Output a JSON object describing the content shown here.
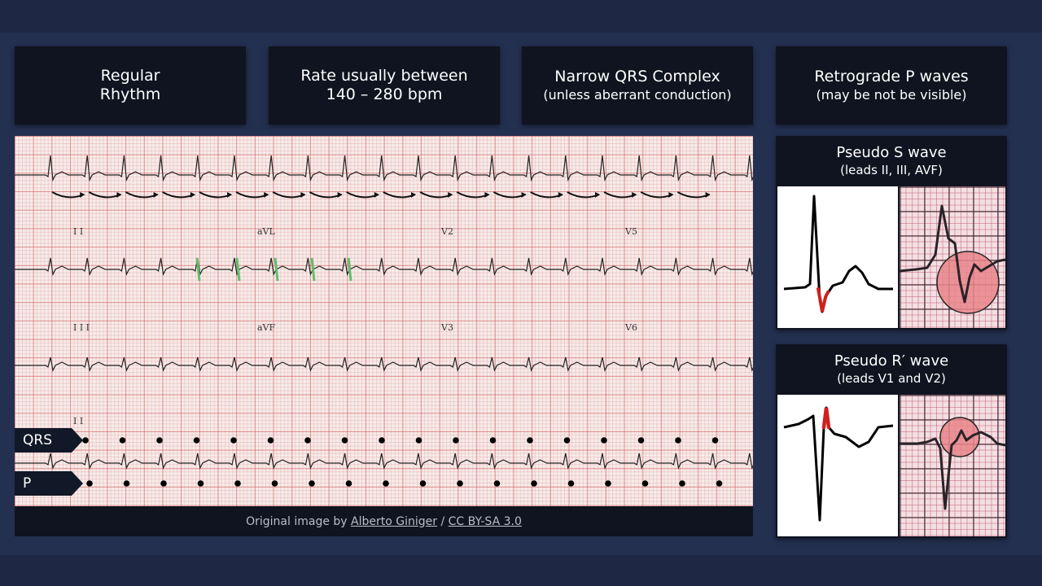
{
  "criteria_cards": [
    {
      "line1": "Regular",
      "line2": "Rhythm",
      "sub": ""
    },
    {
      "line1": "Rate usually between",
      "line2": "140 – 280 bpm",
      "sub": ""
    },
    {
      "line1": "Narrow QRS Complex",
      "line2": "",
      "sub": "(unless aberrant conduction)"
    },
    {
      "line1": "Retrograde P waves",
      "line2": "",
      "sub": "(may be not be visible)"
    }
  ],
  "ecg": {
    "lead_labels": {
      "ii_top": "I I",
      "avl": "aVL",
      "v2": "V2",
      "v5": "V5",
      "iii": "I I I",
      "avf": "aVF",
      "v3": "V3",
      "v6": "V6",
      "ii_rhythm": "I I"
    },
    "markers": {
      "qrs_label": "QRS",
      "p_label": "P",
      "qrs_count": 18,
      "p_count": 18
    },
    "colors": {
      "trace": "#222222",
      "arrow": "#111111",
      "highlight": "#5fbf6a",
      "dot": "#000000"
    }
  },
  "caption": {
    "prefix": "Original image by ",
    "author": "Alberto Giniger",
    "separator": " / ",
    "license": "CC BY-SA 3.0"
  },
  "side_panels": {
    "pseudo_s": {
      "title": "Pseudo S wave",
      "subtitle": "(leads II, III, AVF)"
    },
    "pseudo_r": {
      "title": "Pseudo R′ wave",
      "subtitle": "(leads V1 and V2)"
    }
  },
  "colors": {
    "background": "#243050",
    "card": "#0f1420",
    "highlight_red": "#d0201e",
    "zoom_circle": "#e8858a"
  }
}
